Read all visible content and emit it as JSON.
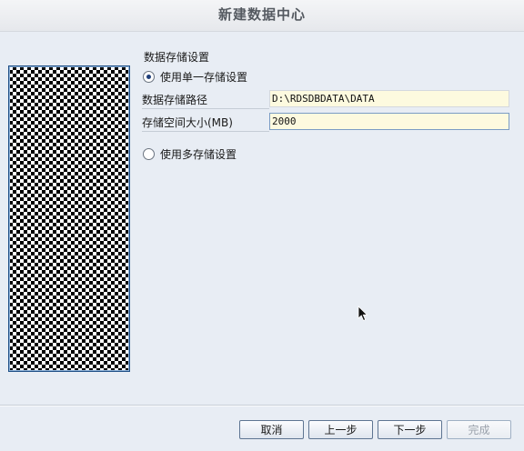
{
  "window": {
    "title": "新建数据中心"
  },
  "storage": {
    "section_title": "数据存储设置",
    "single_option_label": "使用单一存储设置",
    "single_selected": true,
    "path_label": "数据存储路径",
    "path_value": "D:\\RDSDBDATA\\DATA",
    "size_label": "存储空间大小(MB)",
    "size_value": "2000",
    "multi_option_label": "使用多存储设置",
    "multi_selected": false
  },
  "footer": {
    "cancel_label": "取消",
    "prev_label": "上一步",
    "next_label": "下一步",
    "finish_label": "完成"
  },
  "colors": {
    "background": "#e8edf4",
    "input_background": "#fdfadf",
    "banner_border": "#1f4f86"
  }
}
